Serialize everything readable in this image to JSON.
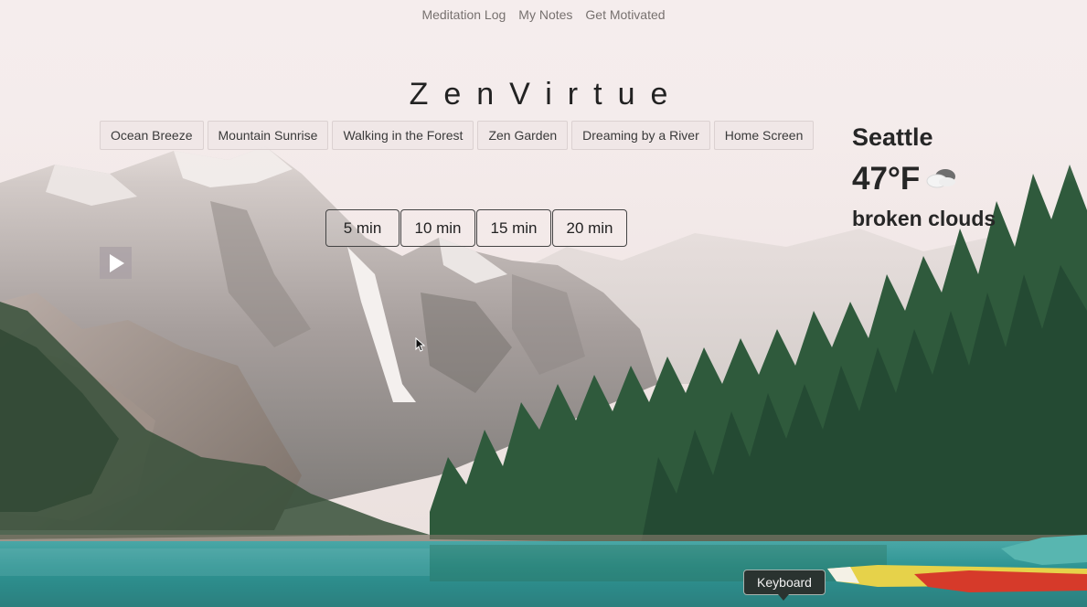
{
  "nav": {
    "items": [
      "Meditation Log",
      "My Notes",
      "Get Motivated"
    ]
  },
  "app": {
    "title": "ZenVirtue"
  },
  "scenes": {
    "items": [
      "Ocean Breeze",
      "Mountain Sunrise",
      "Walking in the Forest",
      "Zen Garden",
      "Dreaming by a River",
      "Home Screen"
    ]
  },
  "durations": {
    "items": [
      "5 min",
      "10 min",
      "15 min",
      "20 min"
    ]
  },
  "player": {
    "icon": "play-icon"
  },
  "weather": {
    "city": "Seattle",
    "temperature": "47°F",
    "icon": "broken-clouds-icon",
    "description": "broken clouds"
  },
  "tooltip": {
    "text": "Keyboard"
  },
  "colors": {
    "sky": "#f3e8e8",
    "lake": "#2f9a98",
    "forest": "#2f5a3c",
    "text": "#262626"
  }
}
